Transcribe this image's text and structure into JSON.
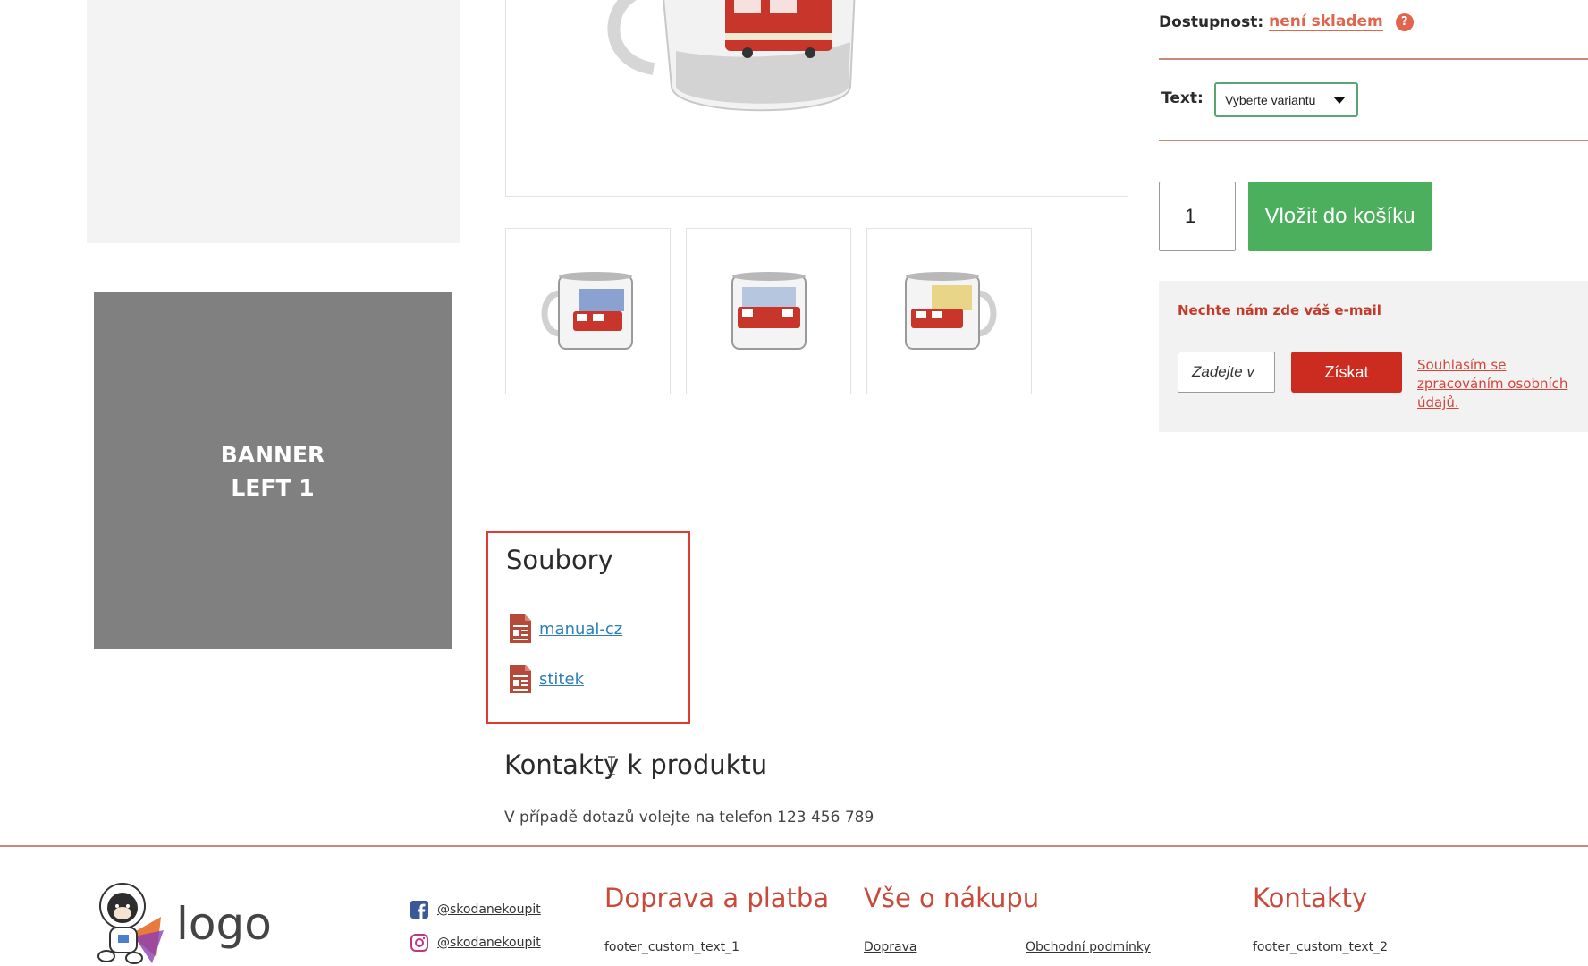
{
  "sidebar": {
    "banner_label": "BANNER\nLEFT 1"
  },
  "product": {
    "availability_label": "Dostupnost:",
    "availability_status": "není skladem",
    "help_icon": "question-circle-icon",
    "variant_label": "Text:",
    "variant_select_value": "Vyberte variantu",
    "quantity": "1",
    "add_to_cart_label": "Vložit do košíku",
    "thumbnails": [
      "mug-thumb-1",
      "mug-thumb-2",
      "mug-thumb-3"
    ]
  },
  "email_capture": {
    "title": "Nechte nám zde váš e-mail",
    "input_placeholder": "Zadejte v",
    "submit_label": "Získat",
    "consent_text": "Souhlasím se zpracováním osobních údajů."
  },
  "files": {
    "title": "Soubory",
    "items": [
      {
        "label": "manual-cz",
        "icon": "pdf-icon"
      },
      {
        "label": "stitek",
        "icon": "pdf-icon"
      }
    ]
  },
  "contact": {
    "title": "Kontakty k produktu",
    "text": "V případě dotazů volejte na telefon 123 456 789"
  },
  "footer": {
    "logo_text": "logo",
    "social": [
      {
        "icon": "facebook-icon",
        "handle": "@skodanekoupit"
      },
      {
        "icon": "instagram-icon",
        "handle": "@skodanekoupit"
      }
    ],
    "col1": {
      "heading": "Doprava a platba",
      "text": "footer_custom_text_1"
    },
    "col2": {
      "heading": "Vše o nákupu",
      "links": [
        "Doprava",
        "Obchodní podmínky"
      ]
    },
    "col3": {
      "heading": "Kontakty",
      "text": "footer_custom_text_2"
    }
  },
  "colors": {
    "accent_red": "#cc2c20",
    "cart_green": "#4caf5e",
    "link_blue": "#2d7fb8",
    "status_orange": "#e0654c"
  }
}
